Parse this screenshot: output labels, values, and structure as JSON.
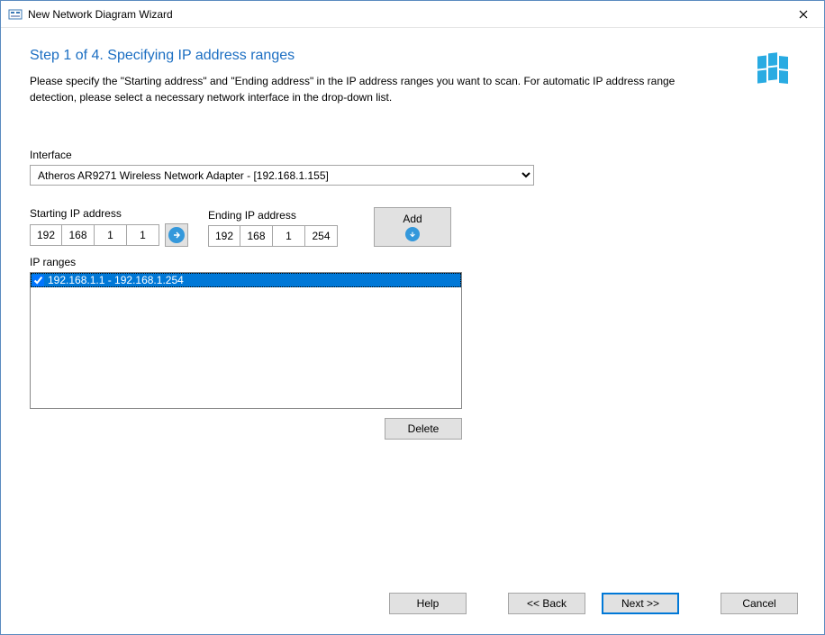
{
  "window": {
    "title": "New Network Diagram Wizard"
  },
  "heading": "Step 1 of 4. Specifying IP address ranges",
  "instruction": "Please specify the \"Starting address\" and \"Ending address\" in the IP address ranges you want to scan. For automatic IP address range detection, please select a necessary network interface in the drop-down list.",
  "interface": {
    "label": "Interface",
    "selected": "Atheros AR9271 Wireless Network Adapter - [192.168.1.155]"
  },
  "starting": {
    "label": "Starting IP address",
    "o1": "192",
    "o2": "168",
    "o3": "1",
    "o4": "1"
  },
  "ending": {
    "label": "Ending IP address",
    "o1": "192",
    "o2": "168",
    "o3": "1",
    "o4": "254"
  },
  "buttons": {
    "add": "Add",
    "delete": "Delete",
    "help": "Help",
    "back": "<< Back",
    "next": "Next >>",
    "cancel": "Cancel"
  },
  "ranges": {
    "label": "IP ranges",
    "items": [
      {
        "text": "192.168.1.1 - 192.168.1.254",
        "checked": true,
        "selected": true
      }
    ]
  }
}
